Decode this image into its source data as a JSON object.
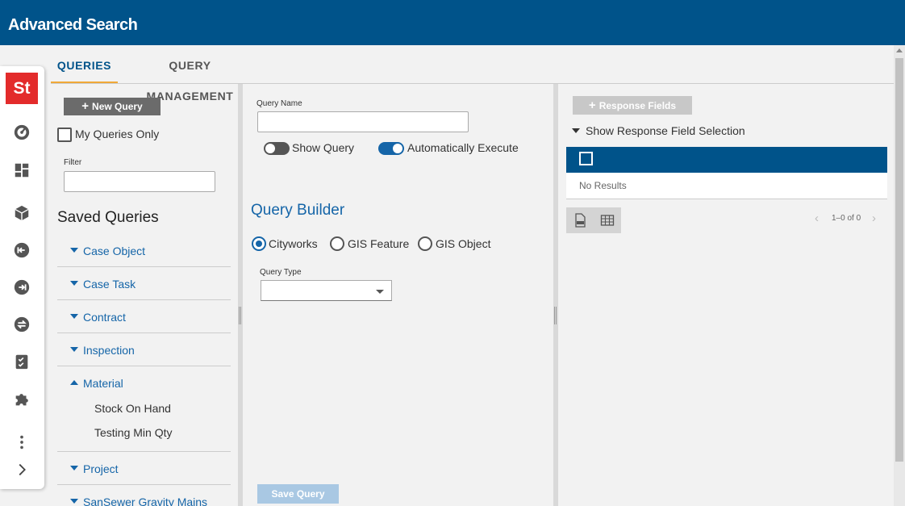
{
  "app": {
    "title": "Advanced Search",
    "logo_text": "St"
  },
  "rail": {
    "icons": [
      "gauge-icon",
      "dashboard-icon",
      "box-icon",
      "sign-in-icon",
      "sign-out-icon",
      "swap-icon",
      "checklist-icon",
      "puzzle-icon",
      "more-vertical-icon",
      "chevron-right-icon"
    ]
  },
  "tabs": [
    {
      "label": "QUERIES",
      "active": true
    },
    {
      "label": "QUERY MANAGEMENT",
      "active": false
    }
  ],
  "left": {
    "new_query_label": "New Query",
    "my_queries_label": "My Queries Only",
    "my_queries_checked": false,
    "filter_label": "Filter",
    "filter_value": "",
    "saved_title": "Saved Queries",
    "items": [
      {
        "label": "Case Object",
        "expanded": false
      },
      {
        "label": "Case Task",
        "expanded": false
      },
      {
        "label": "Contract",
        "expanded": false
      },
      {
        "label": "Inspection",
        "expanded": false
      },
      {
        "label": "Material",
        "expanded": true,
        "children": [
          "Stock On Hand",
          "Testing Min Qty"
        ]
      },
      {
        "label": "Project",
        "expanded": false
      },
      {
        "label": "SanSewer Gravity Mains",
        "expanded": false
      }
    ]
  },
  "middle": {
    "query_name_label": "Query Name",
    "query_name_value": "",
    "show_query_label": "Show Query",
    "show_query_on": false,
    "auto_exec_label": "Automatically Execute",
    "auto_exec_on": true,
    "builder_title": "Query Builder",
    "sources": [
      {
        "label": "Cityworks",
        "selected": true
      },
      {
        "label": "GIS Feature",
        "selected": false
      },
      {
        "label": "GIS Object",
        "selected": false
      }
    ],
    "query_type_label": "Query Type",
    "query_type_value": "",
    "save_label": "Save Query"
  },
  "right": {
    "response_fields_label": "Response Fields",
    "show_selection_label": "Show Response Field Selection",
    "no_results": "No Results",
    "pager": "1–0 of 0"
  },
  "colors": {
    "brand": "#00538a",
    "accent_tab": "#f0a838",
    "link": "#1565a8",
    "logo_red": "#e32b2b"
  }
}
